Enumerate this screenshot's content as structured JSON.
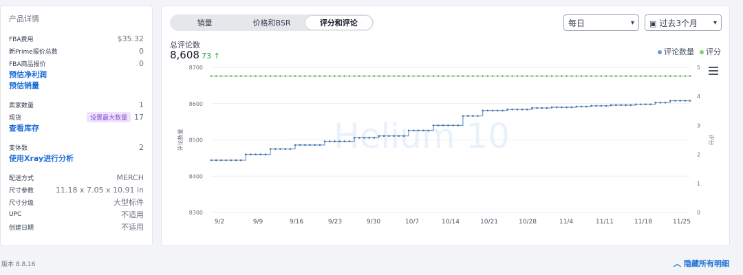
{
  "product": {
    "title": "产品详情",
    "fba_fee_label": "FBA费用",
    "fba_fee": "$35.32",
    "new_prime_label": "新Prime报价总数",
    "new_prime": "0",
    "fba_offer_label": "FBA商品报价",
    "fba_offer": "0",
    "link_profit": "预估净利润",
    "link_sales": "预估销量",
    "sellers_label": "卖家数量",
    "sellers": "1",
    "stock_label": "现货",
    "stock_badge": "设置最大数量",
    "stock": "17",
    "link_inventory": "查看库存",
    "variants_label": "变体数",
    "variants": "2",
    "link_xray": "使用Xray进行分析",
    "fulfill_label": "配送方式",
    "fulfill": "MERCH",
    "dims_label": "尺寸参数",
    "dims": "11.18 x 7.05 x 10.91 in",
    "size_tier_label": "尺寸分级",
    "size_tier": "大型标件",
    "upc_label": "UPC",
    "upc": "不适用",
    "created_label": "创建日期",
    "created": "不适用"
  },
  "tabs": [
    "销量",
    "价格和BSR",
    "评分和评论"
  ],
  "active_tab": 2,
  "controls": {
    "frequency": "每日",
    "range": "过去3个月"
  },
  "summary": {
    "label": "总评论数",
    "value": "8,608",
    "delta": "73 ↑"
  },
  "legend": {
    "reviews": "评论数量",
    "rating": "评分"
  },
  "colors": {
    "reviews": "#6b9bd1",
    "rating": "#7bcf6a",
    "accent": "#1d6fd6"
  },
  "watermark": "Helium 10",
  "footer": {
    "version": "版本 8.8.16",
    "hide_link": "隐藏所有明细"
  },
  "chart_data": {
    "type": "line",
    "xlabel": "",
    "ylabel": "评论数量",
    "y2label": "评分",
    "ylim": [
      8300,
      8700
    ],
    "y2lim": [
      0,
      5
    ],
    "yticks": [
      8300,
      8400,
      8500,
      8600,
      8700
    ],
    "y2ticks": [
      0,
      1,
      2,
      3,
      4,
      5
    ],
    "xticks": [
      "9/2",
      "9/9",
      "9/16",
      "9/23",
      "9/30",
      "10/7",
      "10/14",
      "10/21",
      "10/28",
      "11/4",
      "11/11",
      "11/18",
      "11/25"
    ],
    "series": [
      {
        "name": "评论数量",
        "values": [
          8444,
          8444,
          8444,
          8444,
          8444,
          8444,
          8444,
          8460,
          8460,
          8460,
          8460,
          8460,
          8475,
          8475,
          8475,
          8475,
          8475,
          8486,
          8486,
          8486,
          8486,
          8486,
          8486,
          8496,
          8496,
          8496,
          8496,
          8496,
          8496,
          8506,
          8506,
          8506,
          8506,
          8506,
          8511,
          8511,
          8511,
          8511,
          8511,
          8511,
          8526,
          8526,
          8526,
          8526,
          8526,
          8540,
          8540,
          8540,
          8540,
          8540,
          8540,
          8566,
          8566,
          8566,
          8566,
          8581,
          8581,
          8581,
          8581,
          8581,
          8584,
          8584,
          8584,
          8584,
          8584,
          8588,
          8588,
          8588,
          8588,
          8590,
          8590,
          8590,
          8590,
          8590,
          8592,
          8592,
          8592,
          8594,
          8594,
          8594,
          8594,
          8596,
          8596,
          8596,
          8596,
          8596,
          8598,
          8598,
          8598,
          8598,
          8603,
          8603,
          8603,
          8608,
          8608,
          8608,
          8608,
          8608
        ]
      },
      {
        "name": "评分",
        "values": [
          4.7,
          4.7,
          4.7,
          4.7,
          4.7,
          4.7,
          4.7,
          4.7,
          4.7,
          4.7,
          4.7,
          4.7,
          4.7,
          4.7,
          4.7,
          4.7,
          4.7,
          4.7,
          4.7,
          4.7,
          4.7,
          4.7,
          4.7,
          4.7,
          4.7,
          4.7,
          4.7,
          4.7,
          4.7,
          4.7,
          4.7,
          4.7,
          4.7,
          4.7,
          4.7,
          4.7,
          4.7,
          4.7,
          4.7,
          4.7,
          4.7,
          4.7,
          4.7,
          4.7,
          4.7,
          4.7,
          4.7,
          4.7,
          4.7,
          4.7,
          4.7,
          4.7,
          4.7,
          4.7,
          4.7,
          4.7,
          4.7,
          4.7,
          4.7,
          4.7,
          4.7,
          4.7,
          4.7,
          4.7,
          4.7,
          4.7,
          4.7,
          4.7,
          4.7,
          4.7,
          4.7,
          4.7,
          4.7,
          4.7,
          4.7,
          4.7,
          4.7,
          4.7,
          4.7,
          4.7,
          4.7,
          4.7,
          4.7,
          4.7,
          4.7,
          4.7,
          4.7,
          4.7,
          4.7,
          4.7,
          4.7,
          4.7,
          4.7,
          4.7,
          4.7,
          4.7,
          4.7,
          4.7
        ]
      }
    ]
  }
}
